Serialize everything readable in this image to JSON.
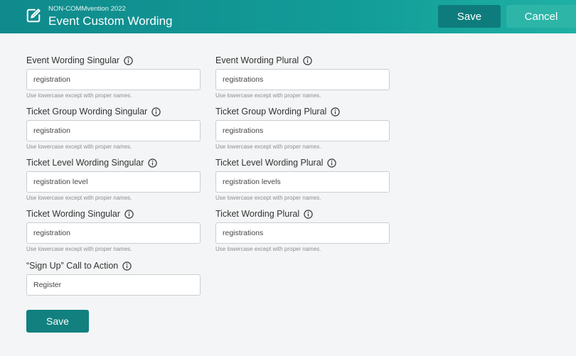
{
  "header": {
    "subtitle": "NON-COMMvention 2022",
    "title": "Event Custom Wording",
    "save_label": "Save",
    "cancel_label": "Cancel",
    "icon": "edit-icon"
  },
  "fields": [
    {
      "label": "Event Wording Singular",
      "value": "registration",
      "hint": "Use lowercase except with proper names."
    },
    {
      "label": "Event Wording Plural",
      "value": "registrations",
      "hint": "Use lowercase except with proper names."
    },
    {
      "label": "Ticket Group Wording Singular",
      "value": "registration",
      "hint": "Use lowercase except with proper names."
    },
    {
      "label": "Ticket Group Wording Plural",
      "value": "registrations",
      "hint": "Use lowercase except with proper names."
    },
    {
      "label": "Ticket Level Wording Singular",
      "value": "registration level",
      "hint": "Use lowercase except with proper names."
    },
    {
      "label": "Ticket Level Wording Plural",
      "value": "registration levels",
      "hint": "Use lowercase except with proper names."
    },
    {
      "label": "Ticket Wording Singular",
      "value": "registration",
      "hint": "Use lowercase except with proper names."
    },
    {
      "label": "Ticket Wording Plural",
      "value": "registrations",
      "hint": "Use lowercase except with proper names."
    },
    {
      "label": "“Sign Up” Call to Action",
      "value": "Register",
      "hint": ""
    }
  ],
  "footer": {
    "save_label": "Save"
  }
}
